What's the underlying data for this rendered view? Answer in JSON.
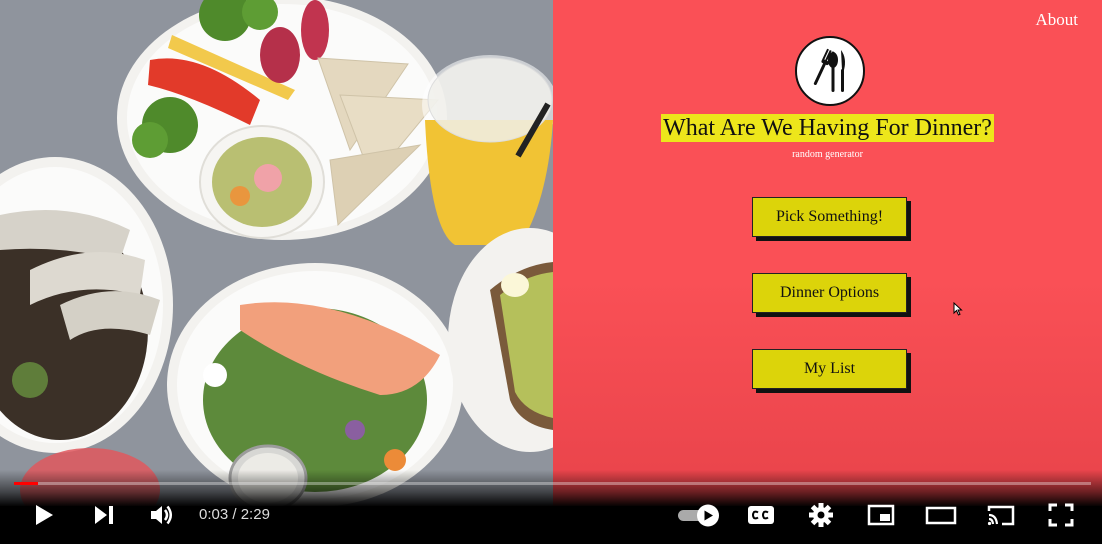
{
  "app": {
    "about_link": "About",
    "title": "What Are We Having For Dinner?",
    "subtitle": "random generator",
    "buttons": {
      "pick": "Pick Something!",
      "options": "Dinner Options",
      "list": "My List"
    },
    "colors": {
      "background": "#fa5056",
      "title_highlight": "#ede61b",
      "button": "#dcd40a"
    },
    "logo_icon": "fork-spoon-knife-icon"
  },
  "player": {
    "time_current": "0:03",
    "time_total": "2:29",
    "time_separator": " / ",
    "progress": 0.022,
    "volume_on": true,
    "autoplay_on": true,
    "icons": {
      "play": "play-icon",
      "next": "next-icon",
      "volume": "volume-icon",
      "autoplay": "autoplay-toggle-icon",
      "captions": "captions-icon",
      "settings": "gear-icon",
      "miniplayer": "miniplayer-icon",
      "theater": "theater-mode-icon",
      "cast": "cast-icon",
      "fullscreen": "fullscreen-icon"
    },
    "colors": {
      "progress": "#ff0000"
    }
  }
}
